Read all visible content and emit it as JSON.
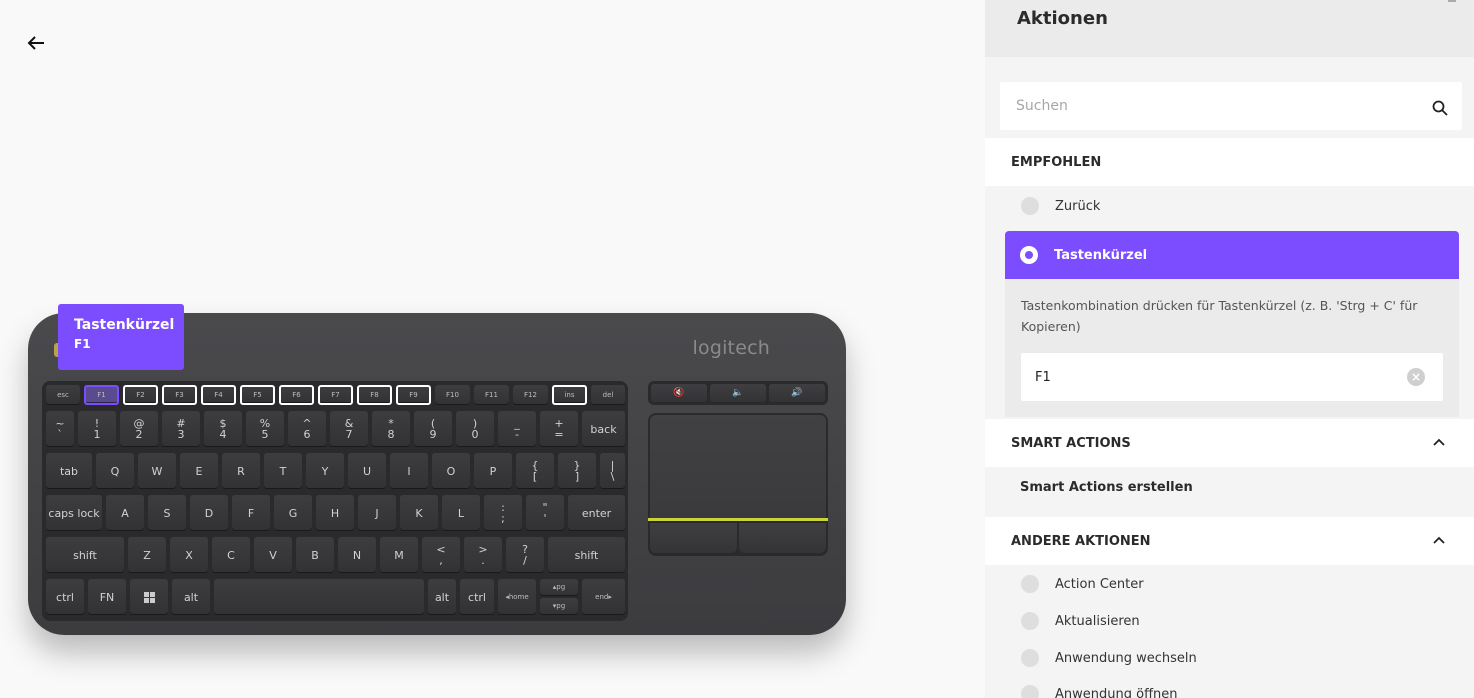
{
  "keyboard": {
    "brand": "logitech",
    "tooltip": {
      "title": "Tastenkürzel",
      "key": "F1"
    },
    "keys": {
      "esc": "esc",
      "f1": "F1",
      "f2": "F2",
      "f3": "F3",
      "f4": "F4",
      "f5": "F5",
      "f6": "F6",
      "f7": "F7",
      "f8": "F8",
      "f9": "F9",
      "f10": "F10",
      "f11": "F11",
      "f12": "F12",
      "ins": "ins",
      "del": "del",
      "tab": "tab",
      "caps": "caps lock",
      "shift_l": "shift",
      "shift_r": "shift",
      "enter": "enter",
      "back": "back",
      "ctrl_l": "ctrl",
      "fn": "FN",
      "alt_l": "alt",
      "alt_r": "alt",
      "ctrl_r": "ctrl",
      "home": "◂home",
      "end": "end▸",
      "pgup": "▴pg",
      "pgdn": "▾pg"
    }
  },
  "panel": {
    "title": "Aktionen",
    "search_placeholder": "Suchen",
    "recommended": {
      "label": "EMPFOHLEN",
      "items": [
        {
          "label": "Zurück"
        },
        {
          "label": "Tastenkürzel"
        }
      ],
      "detail_text": "Tastenkombination drücken für Tastenkürzel (z. B. 'Strg + C' für Kopieren)",
      "shortcut_value": "F1"
    },
    "smart_actions": {
      "label": "SMART ACTIONS",
      "create_label": "Smart Actions erstellen"
    },
    "other_actions": {
      "label": "ANDERE AKTIONEN",
      "items": [
        {
          "label": "Action Center"
        },
        {
          "label": "Aktualisieren"
        },
        {
          "label": "Anwendung wechseln"
        },
        {
          "label": "Anwendung öffnen"
        }
      ]
    }
  },
  "colors": {
    "accent": "#7c4dff",
    "pad_line": "#c9d43a"
  }
}
